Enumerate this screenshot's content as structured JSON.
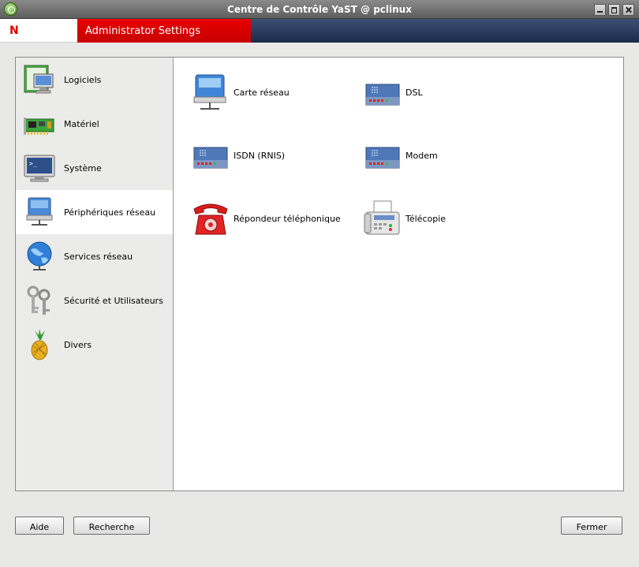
{
  "window": {
    "title": "Centre de Contrôle YaST @ pclinux"
  },
  "banner": {
    "logo_letter": "N",
    "title": "Administrator Settings"
  },
  "sidebar": {
    "items": [
      {
        "label": "Logiciels",
        "icon": "software-icon",
        "selected": false
      },
      {
        "label": "Matériel",
        "icon": "hardware-card-icon",
        "selected": false
      },
      {
        "label": "Système",
        "icon": "system-monitor-icon",
        "selected": false
      },
      {
        "label": "Périphériques réseau",
        "icon": "network-device-icon",
        "selected": true
      },
      {
        "label": "Services réseau",
        "icon": "globe-icon",
        "selected": false
      },
      {
        "label": "Sécurité et Utilisateurs",
        "icon": "keys-icon",
        "selected": false
      },
      {
        "label": "Divers",
        "icon": "pineapple-icon",
        "selected": false
      }
    ]
  },
  "modules": [
    {
      "label": "Carte réseau",
      "icon": "network-card-icon"
    },
    {
      "label": "DSL",
      "icon": "modem-icon"
    },
    {
      "label": "ISDN (RNIS)",
      "icon": "modem-icon"
    },
    {
      "label": "Modem",
      "icon": "modem-icon"
    },
    {
      "label": "Répondeur téléphonique",
      "icon": "telephone-icon"
    },
    {
      "label": "Télécopie",
      "icon": "fax-icon"
    }
  ],
  "buttons": {
    "help": "Aide",
    "search": "Recherche",
    "close": "Fermer"
  }
}
